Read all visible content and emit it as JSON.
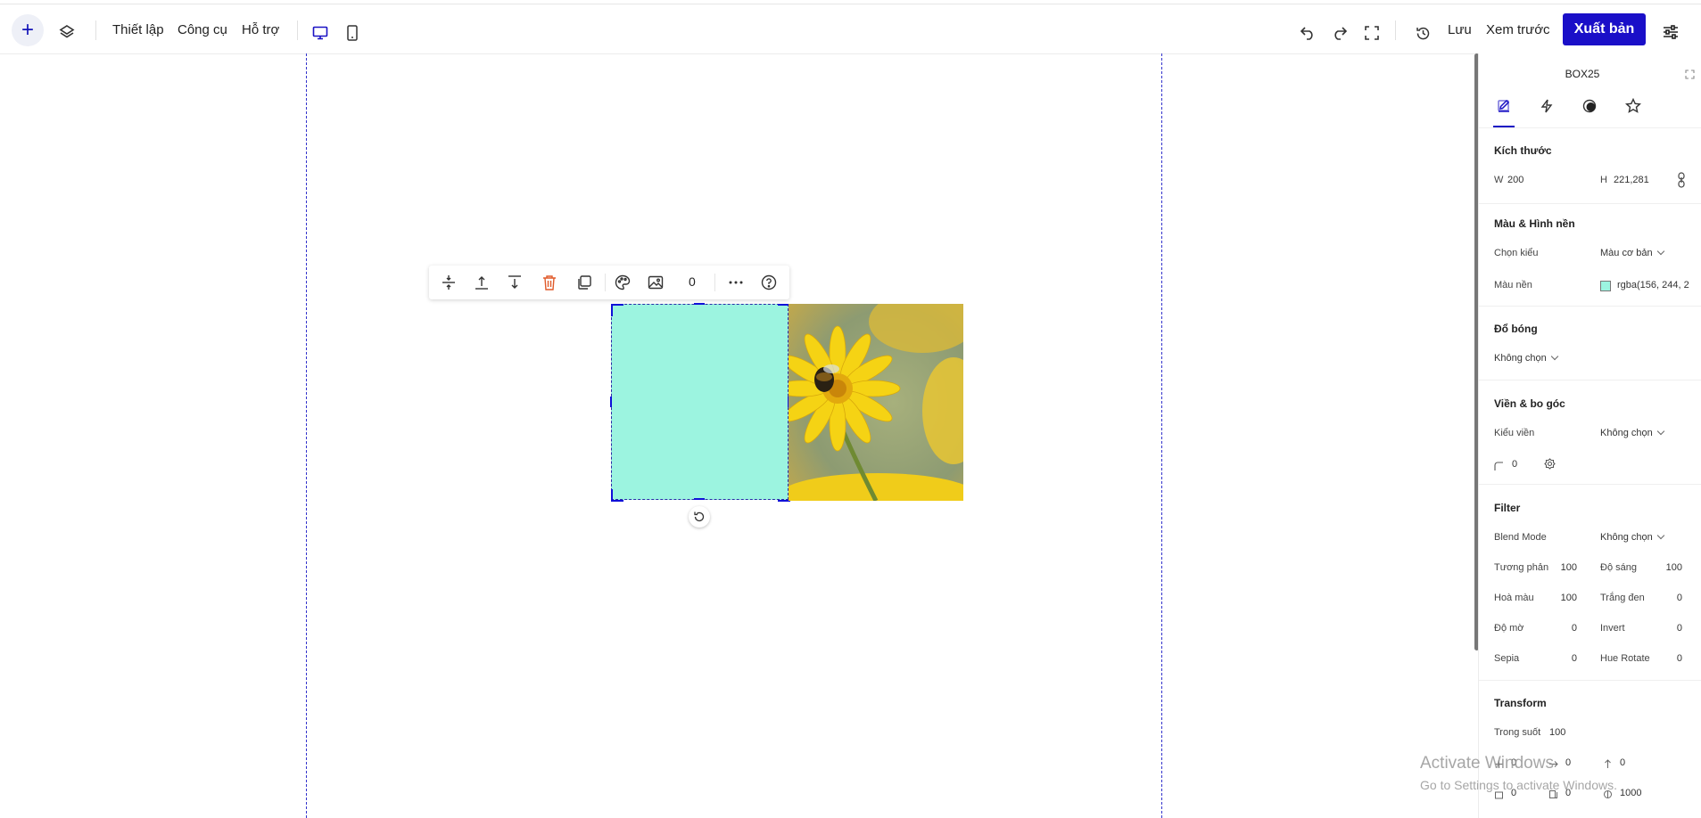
{
  "topbar": {
    "menu": [
      "Thiết lập",
      "Công cụ",
      "Hỗ trợ"
    ],
    "save_label": "Lưu",
    "preview_label": "Xem trước",
    "publish_label": "Xuất bản"
  },
  "toolbar": {
    "opacity_value": "0"
  },
  "element": {
    "background_color": "#9cf4e0"
  },
  "panel": {
    "title": "BOX25",
    "size": {
      "title": "Kích thước",
      "w_label": "W",
      "w_value": "200",
      "h_label": "H",
      "h_value": "221,281"
    },
    "color": {
      "title": "Màu & Hình nền",
      "type_label": "Chọn kiểu",
      "type_value": "Màu cơ bản",
      "bg_label": "Màu nền",
      "bg_value": "rgba(156, 244, 2"
    },
    "shadow": {
      "title": "Đổ bóng",
      "value": "Không chọn"
    },
    "border": {
      "title": "Viền & bo góc",
      "type_label": "Kiểu viền",
      "type_value": "Không chọn",
      "radius_value": "0"
    },
    "filter": {
      "title": "Filter",
      "blend_label": "Blend Mode",
      "blend_value": "Không chọn",
      "rows": [
        {
          "l1": "Tương phản",
          "v1": "100",
          "l2": "Độ sáng",
          "v2": "100"
        },
        {
          "l1": "Hoà màu",
          "v1": "100",
          "l2": "Trắng đen",
          "v2": "0"
        },
        {
          "l1": "Độ mờ",
          "v1": "0",
          "l2": "Invert",
          "v2": "0"
        },
        {
          "l1": "Sepia",
          "v1": "0",
          "l2": "Hue Rotate",
          "v2": "0"
        }
      ]
    },
    "transform": {
      "title": "Transform",
      "opacity_label": "Trong suốt",
      "opacity_value": "100",
      "rotate_x": "0",
      "rotate_y": "0",
      "rotate_z": "0",
      "skew_x": "0",
      "skew_y": "0",
      "perspective": "1000"
    }
  },
  "watermark": {
    "line1": "Activate Windows",
    "line2": "Go to Settings to activate Windows."
  }
}
